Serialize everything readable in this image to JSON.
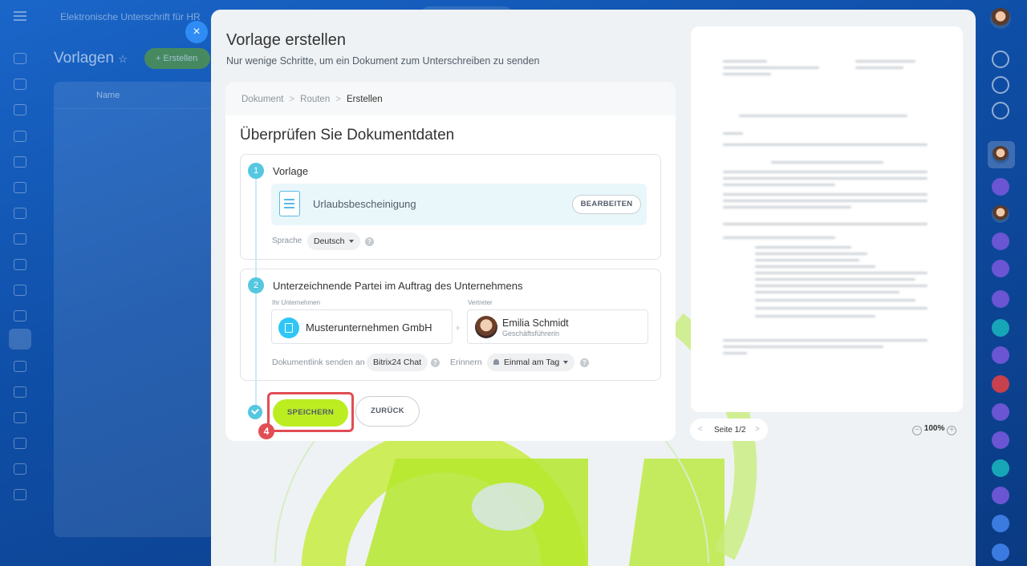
{
  "background": {
    "app_title": "Elektronische Unterschrift für HR",
    "page_title": "Vorlagen",
    "create_button": "+ Erstellen",
    "table_header_name": "Name"
  },
  "slider": {
    "title": "Vorlage erstellen",
    "subtitle": "Nur wenige Schritte, um ein Dokument zum Unterschreiben zu senden",
    "breadcrumb": [
      "Dokument",
      "Routen",
      "Erstellen"
    ],
    "heading": "Überprüfen Sie Dokumentdaten",
    "step1": {
      "number": "1",
      "title": "Vorlage",
      "document_name": "Urlaubsbescheinigung",
      "edit_button": "BEARBEITEN",
      "language_label": "Sprache",
      "language_value": "Deutsch"
    },
    "step2": {
      "number": "2",
      "title": "Unterzeichnende Partei im Auftrag des Unternehmens",
      "company_label": "Ihr Unternehmen",
      "company_name": "Musterunternehmen GmbH",
      "representative_label": "Vertreter",
      "representative_name": "Emilia Schmidt",
      "representative_role": "Geschäftsführerin",
      "send_link_label": "Dokumentlink senden an",
      "send_link_value": "Bitrix24 Chat",
      "remind_label": "Erinnern",
      "remind_value": "Einmal am Tag"
    },
    "save_button": "SPEICHERN",
    "back_button": "ZURÜCK",
    "annotation_badge": "4",
    "preview": {
      "pager": "Seite 1/2",
      "zoom": "100%"
    }
  },
  "colors": {
    "accent_green": "#bbed21",
    "step_teal": "#55c7e0",
    "highlight_red": "#e14e54",
    "close_blue": "#2f8cf5"
  }
}
